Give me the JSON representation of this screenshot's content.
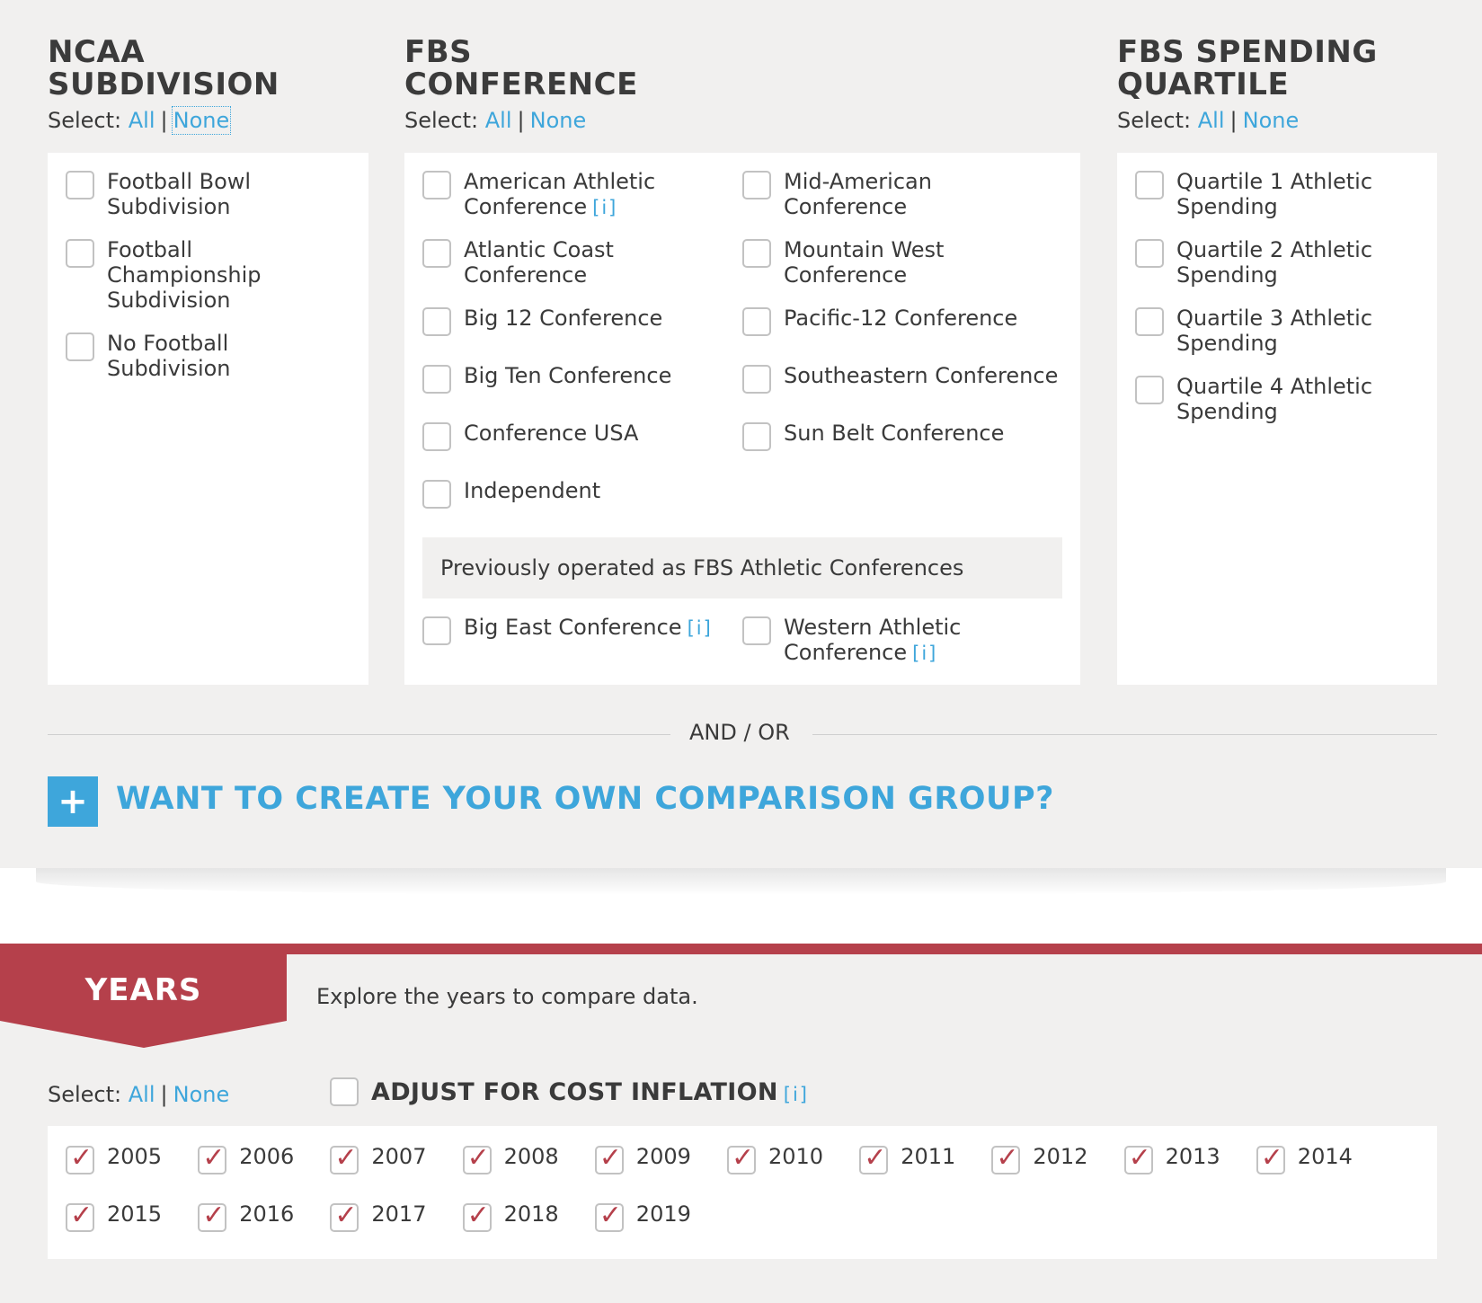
{
  "ncaa": {
    "title_line1": "NCAA",
    "title_line2": "SUBDIVISION",
    "select_label": "Select:",
    "all": "All",
    "none": "None",
    "items": [
      {
        "line1": "Football Bowl",
        "line2": "Subdivision",
        "line3": ""
      },
      {
        "line1": "Football",
        "line2": "Championship",
        "line3": "Subdivision"
      },
      {
        "line1": "No Football",
        "line2": "Subdivision",
        "line3": ""
      }
    ]
  },
  "fbs": {
    "title_line1": "FBS",
    "title_line2": "CONFERENCE",
    "select_label": "Select:",
    "all": "All",
    "none": "None",
    "items": [
      {
        "line1": "American Athletic",
        "line2": "Conference"
      },
      {
        "line1": "Mid-American",
        "line2": "Conference"
      },
      {
        "line1": "Atlantic Coast",
        "line2": "Conference"
      },
      {
        "line1": "Mountain West",
        "line2": "Conference"
      },
      {
        "line1": "Big 12 Conference",
        "line2": ""
      },
      {
        "line1": "Pacific-12 Conference",
        "line2": ""
      },
      {
        "line1": "Big Ten Conference",
        "line2": ""
      },
      {
        "line1": "Southeastern Conference",
        "line2": ""
      },
      {
        "line1": "Conference USA",
        "line2": ""
      },
      {
        "line1": "Sun Belt Conference",
        "line2": ""
      },
      {
        "line1": "Independent",
        "line2": ""
      }
    ],
    "previous_heading": "Previously operated as FBS Athletic Conferences",
    "previous_items": [
      {
        "line1": "Big East Conference",
        "line2": ""
      },
      {
        "line1": "Western Athletic",
        "line2": "Conference"
      }
    ],
    "info_marker": "[i]"
  },
  "quartile": {
    "title_line1": "FBS SPENDING",
    "title_line2": "QUARTILE",
    "select_label": "Select:",
    "all": "All",
    "none": "None",
    "items": [
      {
        "line1": "Quartile 1 Athletic",
        "line2": "Spending"
      },
      {
        "line1": "Quartile 2 Athletic",
        "line2": "Spending"
      },
      {
        "line1": "Quartile 3 Athletic",
        "line2": "Spending"
      },
      {
        "line1": "Quartile 4 Athletic",
        "line2": "Spending"
      }
    ]
  },
  "divider": {
    "text": "AND / OR"
  },
  "create_group": {
    "icon": "plus-icon",
    "label": "WANT TO CREATE YOUR OWN COMPARISON GROUP?"
  },
  "years": {
    "banner_label": "YEARS",
    "description": "Explore the years to compare data.",
    "select_label": "Select:",
    "all": "All",
    "none": "None",
    "inflation_label": "ADJUST FOR COST INFLATION",
    "inflation_checked": false,
    "info_marker": "[i]",
    "list": [
      "2005",
      "2006",
      "2007",
      "2008",
      "2009",
      "2010",
      "2011",
      "2012",
      "2013",
      "2014",
      "2015",
      "2016",
      "2017",
      "2018",
      "2019"
    ],
    "all_checked": true
  },
  "colors": {
    "accent_blue": "#3ea6db",
    "brand_red": "#b5404b",
    "background": "#f1f0ef",
    "panel": "#ffffff",
    "text": "#3a3a3a"
  }
}
